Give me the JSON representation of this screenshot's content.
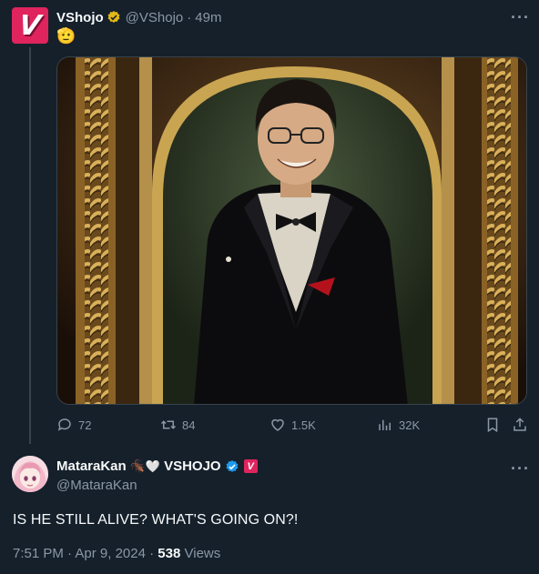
{
  "tweet": {
    "avatar_letter": "V",
    "author_name": "VShojo",
    "handle": "@VShojo",
    "separator": "·",
    "time": "49m",
    "text_emoji": "🫡",
    "more_label": "···",
    "media_icon": "portrait-photo",
    "stats": {
      "replies": "72",
      "retweets": "84",
      "likes": "1.5K",
      "views": "32K"
    }
  },
  "reply": {
    "author_name": "MataraKan",
    "name_emojis": "🪳🤍",
    "affiliation": "VSHOJO",
    "affiliation_badge_letter": "V",
    "handle": "@MataraKan",
    "more_label": "···",
    "text": "IS HE STILL ALIVE? WHAT'S GOING ON?!",
    "time": "7:51 PM",
    "separator": "·",
    "date": "Apr 9, 2024",
    "view_count": "538",
    "views_label": "Views"
  },
  "colors": {
    "background": "#15202b",
    "text": "#f7f9f9",
    "muted": "#8b98a5",
    "gold_verified": "#e2b719",
    "blue_verified": "#1d9bf0",
    "vshojo_pink": "#e0245e"
  }
}
